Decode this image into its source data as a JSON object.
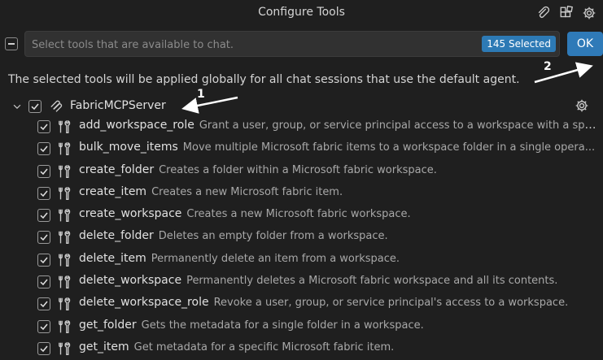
{
  "window": {
    "title": "Configure Tools",
    "title_icons": [
      "paperclip-icon",
      "extensions-icon",
      "gear-icon"
    ]
  },
  "search": {
    "placeholder": "Select tools that are available to chat.",
    "value": "",
    "selected_count": "145 Selected"
  },
  "ok_label": "OK",
  "description": "The selected tools will be applied globally for all chat sessions that use the default agent.",
  "server": {
    "name": "FabricMCPServer",
    "checked": true,
    "expanded": true
  },
  "tools": [
    {
      "name": "add_workspace_role",
      "desc": "Grant a user, group, or service principal access to a workspace with a spe...",
      "checked": true
    },
    {
      "name": "bulk_move_items",
      "desc": "Move multiple Microsoft fabric items to a workspace folder in a single opera...",
      "checked": true
    },
    {
      "name": "create_folder",
      "desc": "Creates a folder within a Microsoft fabric workspace.",
      "checked": true
    },
    {
      "name": "create_item",
      "desc": "Creates a new Microsoft fabric item.",
      "checked": true
    },
    {
      "name": "create_workspace",
      "desc": "Creates a new Microsoft fabric workspace.",
      "checked": true
    },
    {
      "name": "delete_folder",
      "desc": "Deletes an empty folder from a workspace.",
      "checked": true
    },
    {
      "name": "delete_item",
      "desc": "Permanently delete an item from a workspace.",
      "checked": true
    },
    {
      "name": "delete_workspace",
      "desc": "Permanently deletes a Microsoft fabric workspace and all its contents.",
      "checked": true
    },
    {
      "name": "delete_workspace_role",
      "desc": "Revoke a user, group, or service principal's access to a workspace.",
      "checked": true
    },
    {
      "name": "get_folder",
      "desc": "Gets the metadata for a single folder in a workspace.",
      "checked": true
    },
    {
      "name": "get_item",
      "desc": "Get metadata for a specific Microsoft fabric item.",
      "checked": true
    }
  ],
  "annotations": {
    "one": "1",
    "two": "2",
    "color": "#ffffff"
  },
  "colors": {
    "background": "#1f1f1f",
    "accent": "#2f7ab8",
    "badge": "#2d7ab5"
  }
}
